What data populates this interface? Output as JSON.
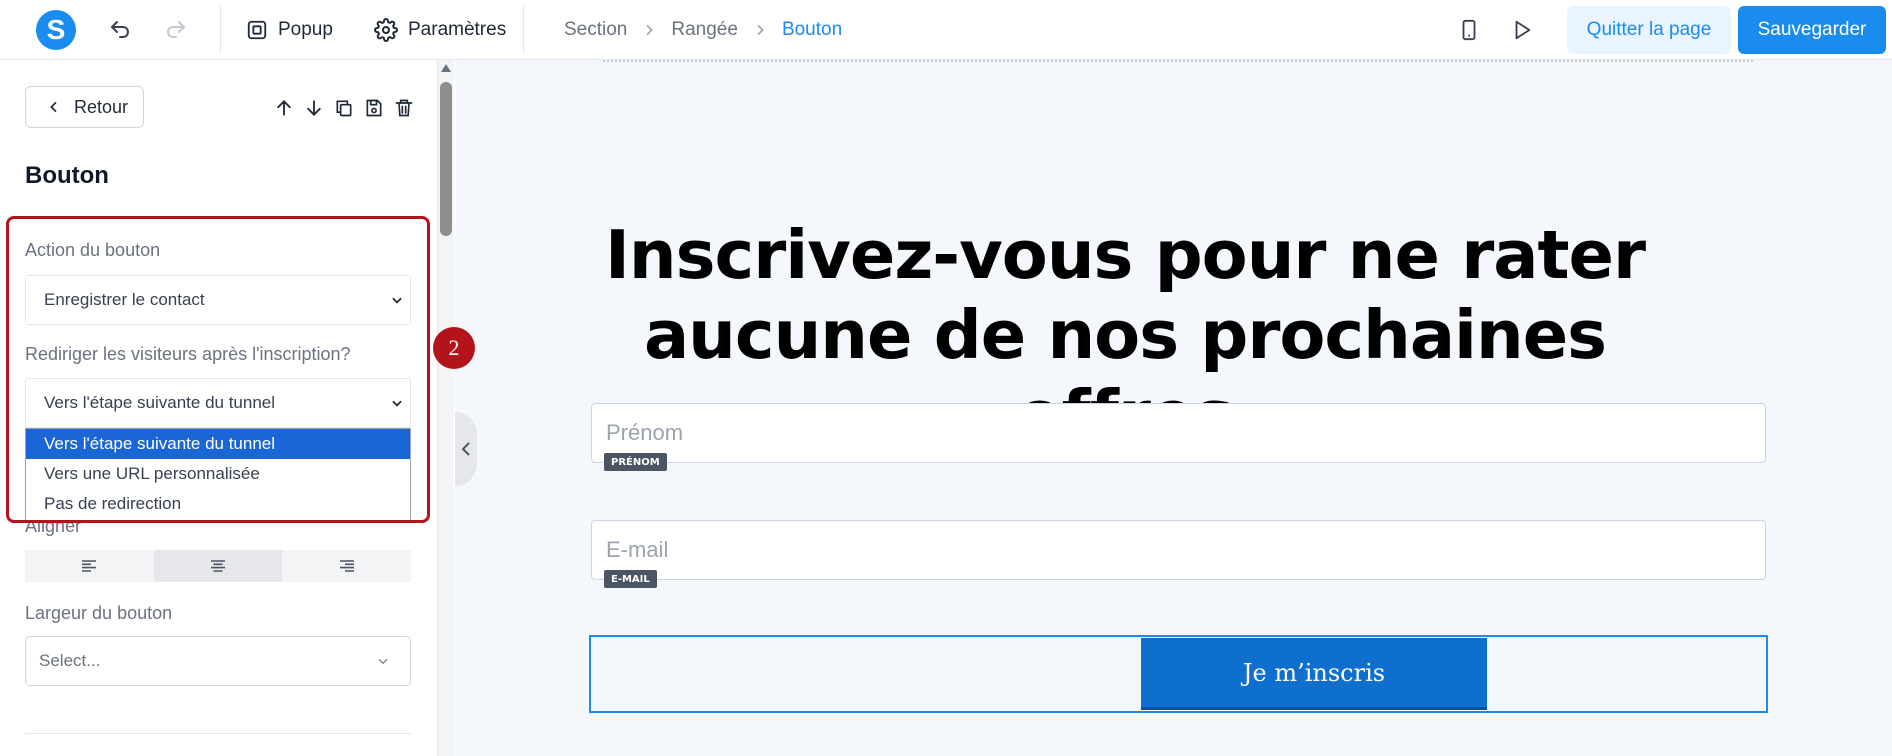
{
  "topbar": {
    "logo_letter": "S",
    "popup_label": "Popup",
    "settings_label": "Paramètres",
    "breadcrumbs": [
      "Section",
      "Rangée",
      "Bouton"
    ],
    "quit_label": "Quitter la page",
    "save_label": "Sauvegarder"
  },
  "panel": {
    "back_label": "Retour",
    "title": "Bouton",
    "action_label": "Action du bouton",
    "action_value": "Enregistrer le contact",
    "redirect_label": "Rediriger les visiteurs après l'inscription?",
    "redirect_value": "Vers l'étape suivante du tunnel",
    "redirect_options": [
      "Vers l'étape suivante du tunnel",
      "Vers une URL personnalisée",
      "Pas de redirection"
    ],
    "align_label": "Aligner",
    "width_label": "Largeur du bouton",
    "width_placeholder": "Select...",
    "step_number": "2"
  },
  "canvas": {
    "headline": "Inscrivez-vous pour ne rater aucune de nos prochaines offres",
    "firstname_placeholder": "Prénom",
    "firstname_tag": "PRÉNOM",
    "email_placeholder": "E-mail",
    "email_tag": "E-MAIL",
    "cta_label": "Je m’inscris"
  },
  "colors": {
    "accent": "#1a8cf0",
    "highlight": "#b3141b",
    "cta": "#0f6fcf",
    "dropdown_selected": "#1a66d6"
  }
}
